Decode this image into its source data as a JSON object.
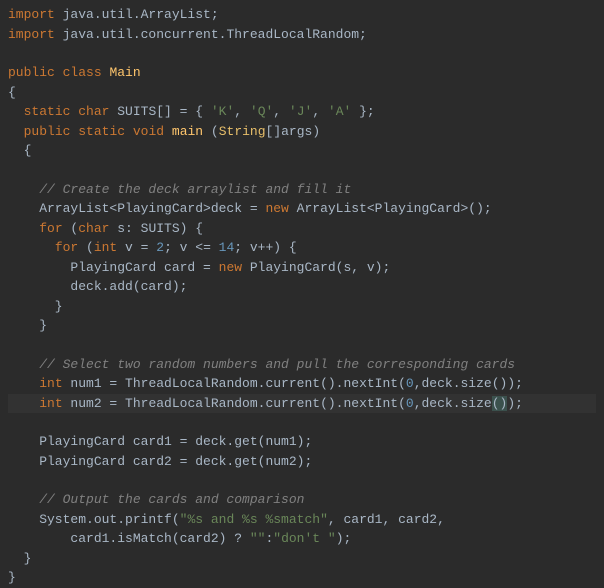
{
  "code": {
    "l1": {
      "kw1": "import",
      "pkg": " java.util.ArrayList;"
    },
    "l2": {
      "kw1": "import",
      "pkg": " java.util.concurrent.ThreadLocalRandom;"
    },
    "l3": "",
    "l4": {
      "kw1": "public",
      "kw2": "class",
      "cls": "Main"
    },
    "l5": "{",
    "l6": {
      "kw1": "static",
      "kw2": "char",
      "var": " SUITS[] = { ",
      "c1": "'K'",
      "s1": ", ",
      "c2": "'Q'",
      "s2": ", ",
      "c3": "'J'",
      "s3": ", ",
      "c4": "'A'",
      "s4": " };"
    },
    "l7": {
      "kw1": "public",
      "kw2": "static",
      "kw3": "void",
      "fn": "main",
      "p1": " (",
      "type": "String",
      "p2": "[]args)"
    },
    "l8": "  {",
    "l9": "",
    "l10": {
      "cm": "    // Create the deck arraylist and fill it"
    },
    "l11": {
      "t1": "    ArrayList<PlayingCard>deck = ",
      "kw": "new",
      "t2": " ArrayList<PlayingCard>();"
    },
    "l12": {
      "kw": "for",
      "t1": " (",
      "kw2": "char",
      "t2": " s: SUITS) {"
    },
    "l13": {
      "kw": "for",
      "t1": " (",
      "kw2": "int",
      "t2": " v = ",
      "n1": "2",
      "t3": "; v <= ",
      "n2": "14",
      "t4": "; v++) {"
    },
    "l14": {
      "t1": "        PlayingCard card = ",
      "kw": "new",
      "t2": " PlayingCard(s, v);"
    },
    "l15": "        deck.add(card);",
    "l16": "      }",
    "l17": "    }",
    "l18": "",
    "l19": {
      "cm": "    // Select two random numbers and pull the corresponding cards"
    },
    "l20": {
      "kw": "int",
      "t1": " num1 = ThreadLocalRandom.current().nextInt(",
      "n1": "0",
      "t2": ",deck.size());"
    },
    "l21": {
      "kw": "int",
      "t1": " num2 = ThreadLocalRandom.current().nextInt(",
      "n1": "0",
      "t2": ",deck.size",
      "hp1": "(",
      "hp2": ")",
      "t3": ");"
    },
    "l22": "",
    "l23": "    PlayingCard card1 = deck.get(num1);",
    "l24": "    PlayingCard card2 = deck.get(num2);",
    "l25": "",
    "l26": {
      "cm": "    // Output the cards and comparison"
    },
    "l27": {
      "t1": "    System.out.printf(",
      "str": "\"%s and %s %smatch\"",
      "t2": ", card1, card2,"
    },
    "l28": {
      "t1": "        card1.isMatch(card2) ? ",
      "s1": "\"\"",
      "t2": ":",
      "s2": "\"don't \"",
      "t3": ");"
    },
    "l29": "  }",
    "l30": "}"
  }
}
